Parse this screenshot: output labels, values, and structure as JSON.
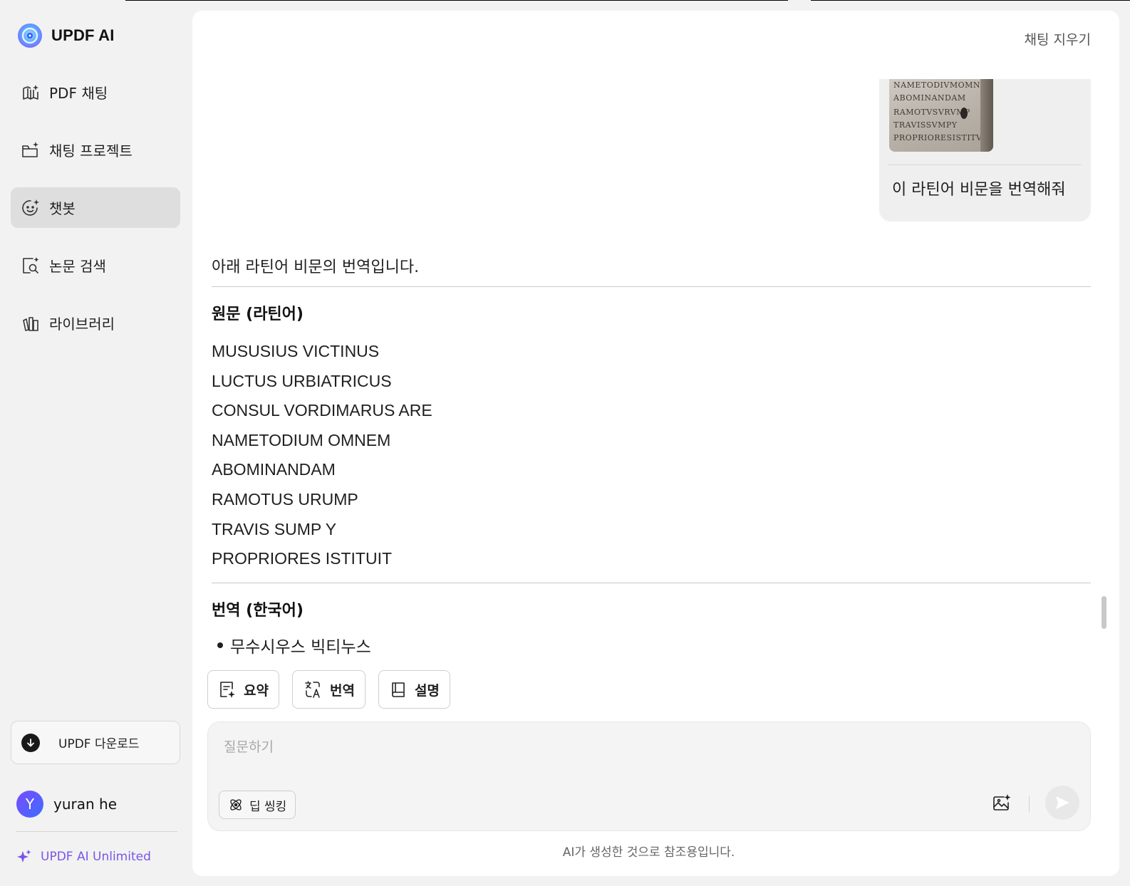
{
  "brand": {
    "name": "UPDF AI"
  },
  "nav": {
    "items": [
      {
        "label": "PDF 채팅",
        "icon": "book-sparkle-icon"
      },
      {
        "label": "채팅 프로젝트",
        "icon": "folder-sparkle-icon"
      },
      {
        "label": "챗봇",
        "icon": "chatbot-face-icon",
        "active": true
      },
      {
        "label": "논문 검색",
        "icon": "document-search-icon"
      },
      {
        "label": "라이브러리",
        "icon": "library-icon"
      }
    ]
  },
  "sidebar": {
    "download_label": "UPDF 다운로드",
    "user": {
      "initial": "Y",
      "name": "yuran he"
    },
    "unlimited_label": "UPDF AI Unlimited"
  },
  "header": {
    "clear_chat": "채팅 지우기"
  },
  "chat": {
    "user_message": {
      "image_lines": [
        "NAMETODIVMOMNE",
        "ABOMINANDAM",
        "RAMOTVSVRVMP",
        "TRAVISSVMPY",
        "PROPRIORESISTITVIT"
      ],
      "text": "이 라틴어 비문을 번역해줘"
    },
    "answer": {
      "intro": "아래 라틴어 비문의 번역입니다.",
      "original_heading": "원문 (라틴어)",
      "latin_lines": [
        "MUSUSIUS VICTINUS",
        "LUCTUS URBIATRICUS",
        "CONSUL VORDIMARUS ARE",
        "NAMETODIUM OMNEM",
        "ABOMINANDAM",
        "RAMOTUS URUMP",
        "TRAVIS SUMP Y",
        "PROPRIORES ISTITUIT"
      ],
      "translation_heading": "번역 (한국어)",
      "translation_items": [
        "무수시우스 빅티누스"
      ]
    }
  },
  "quick_actions": [
    {
      "label": "요약",
      "icon": "summary-icon"
    },
    {
      "label": "번역",
      "icon": "translate-icon"
    },
    {
      "label": "설명",
      "icon": "book-icon"
    }
  ],
  "composer": {
    "placeholder": "질문하기",
    "deep_thinking_label": "딥 씽킹"
  },
  "footer": {
    "disclaimer": "AI가 생성한 것으로 참조용입니다."
  }
}
